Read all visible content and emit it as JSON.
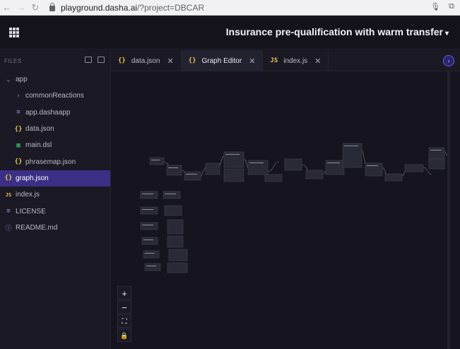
{
  "browser": {
    "url_host": "playground.dasha.ai",
    "url_path": "/?project=DBCAR"
  },
  "app": {
    "project_title": "Insurance pre-qualification with warm transfer"
  },
  "sidebar": {
    "header": "FILES",
    "items": [
      {
        "label": "app",
        "icon": "chevron-down-icon",
        "indent": 0
      },
      {
        "label": "commonReactions",
        "icon": "chevron-right-icon",
        "indent": 1
      },
      {
        "label": "app.dashaapp",
        "icon": "lines-icon",
        "indent": 1
      },
      {
        "label": "data.json",
        "icon": "braces-icon",
        "indent": 1
      },
      {
        "label": "main.dsl",
        "icon": "dsl-icon",
        "indent": 1
      },
      {
        "label": "phrasemap.json",
        "icon": "braces-icon",
        "indent": 1
      },
      {
        "label": "graph.json",
        "icon": "braces-icon",
        "indent": 0,
        "selected": true
      },
      {
        "label": "index.js",
        "icon": "js-icon",
        "indent": 0
      },
      {
        "label": "LICENSE",
        "icon": "lines-icon",
        "indent": 0
      },
      {
        "label": "README.md",
        "icon": "info-icon",
        "indent": 0
      }
    ]
  },
  "tabs": [
    {
      "label": "data.json",
      "icon": "{}"
    },
    {
      "label": "Graph Editor",
      "icon": "{}",
      "active": true
    },
    {
      "label": "index.js",
      "icon": "JS"
    }
  ],
  "zoom_controls": [
    "+",
    "−",
    "⛶",
    "🔒"
  ],
  "colors": {
    "accent": "#3b2f86",
    "background": "#16151f",
    "sidebar": "#1b1a24"
  }
}
